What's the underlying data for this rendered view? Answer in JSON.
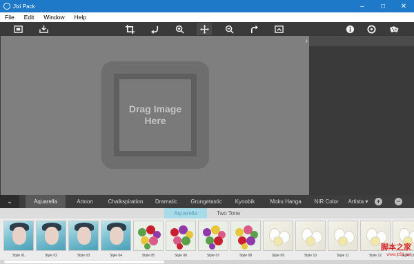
{
  "titlebar": {
    "title": "Jixi Pack",
    "min_glyph": "–",
    "max_glyph": "□",
    "close_glyph": "✕"
  },
  "menu": [
    "File",
    "Edit",
    "Window",
    "Help"
  ],
  "toolbar": {
    "left": [
      "open-image-icon",
      "save-icon"
    ],
    "center": [
      "crop-icon",
      "undo-icon",
      "zoom-in-icon",
      "move-icon",
      "zoom-out-icon",
      "redo-icon",
      "fit-screen-icon"
    ],
    "right": [
      "info-icon",
      "settings-icon",
      "random-dice-icon"
    ],
    "active": "move-icon"
  },
  "canvas": {
    "drop_text": "Drag Image\nHere",
    "expand_glyph": "›"
  },
  "categories": {
    "toggle_glyph": "⌄",
    "tabs": [
      "Aquarella",
      "Artoon",
      "Chalkspiration",
      "Dramatic",
      "Grungetastic",
      "Kyoobik",
      "Moku Hanga",
      "NIR Color",
      "Artista ▾"
    ],
    "selected": "Aquarella",
    "add_glyph": "+",
    "remove_glyph": "−"
  },
  "subtabs": {
    "items": [
      "Aquarella",
      "Two Tone"
    ],
    "selected": "Aquarella"
  },
  "styles": [
    {
      "label": "Style 01",
      "art": "portrait"
    },
    {
      "label": "Style 02",
      "art": "portrait"
    },
    {
      "label": "Style 03",
      "art": "portrait"
    },
    {
      "label": "Style 04",
      "art": "portrait"
    },
    {
      "label": "Style 05",
      "art": "flowers"
    },
    {
      "label": "Style 06",
      "art": "flowers"
    },
    {
      "label": "Style 07",
      "art": "flowers"
    },
    {
      "label": "Style 08",
      "art": "flowers"
    },
    {
      "label": "Style 09",
      "art": "white"
    },
    {
      "label": "Style 10",
      "art": "white"
    },
    {
      "label": "Style 11",
      "art": "white"
    },
    {
      "label": "Style 12",
      "art": "white"
    },
    {
      "label": "Style 13",
      "art": "white"
    }
  ],
  "watermark": {
    "text": "脚本之家",
    "url": "www.jb51.net"
  },
  "colors": {
    "titlebar": "#1e79c9",
    "accent_subtab": "#a8dbe9",
    "canvas": "#7f7f7f"
  }
}
